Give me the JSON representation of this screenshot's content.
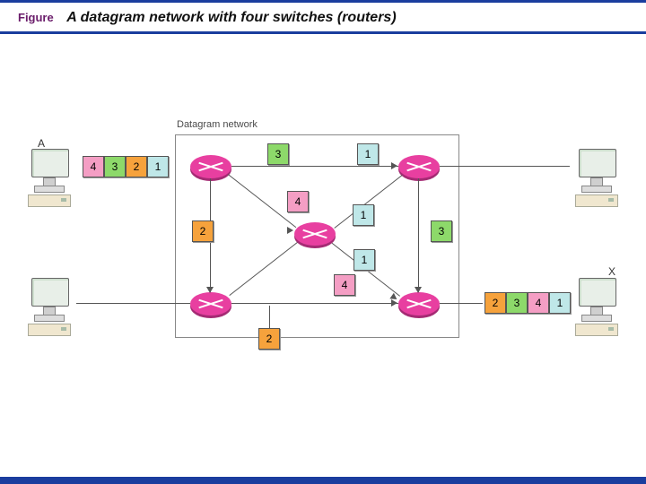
{
  "header": {
    "figLabel": "Figure",
    "figTitle": "A datagram network with four switches (routers)"
  },
  "diagram": {
    "networkLabel": "Datagram network",
    "hosts": {
      "A": "A",
      "X": "X"
    },
    "packets": {
      "hostA_out": [
        "4",
        "3",
        "2",
        "1"
      ],
      "hostX_in": [
        "2",
        "3",
        "4",
        "1"
      ],
      "top_mid_left": "3",
      "top_mid_right": "1",
      "center_top": "4",
      "center_right": "1",
      "left_down": "2",
      "right_down": "3",
      "bottom_center_upper": "1",
      "bottom_center_lower": "4",
      "bottom_out": "2"
    }
  }
}
